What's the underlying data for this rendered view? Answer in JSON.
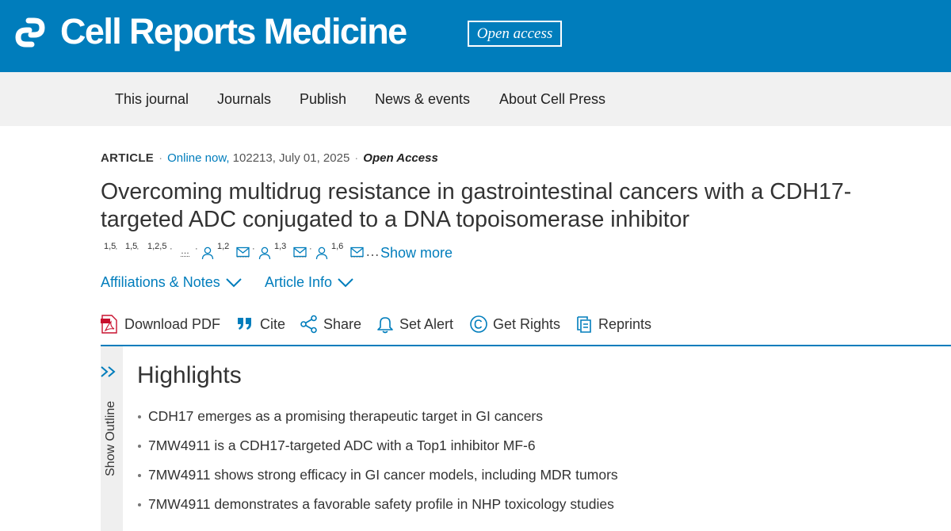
{
  "header": {
    "brand": "Cell Reports Medicine",
    "badge": "Open access",
    "logo_icon": "cell-press-logo-icon",
    "colors": {
      "brand_blue": "#007dbc",
      "nav_bg": "#f1f1f1"
    }
  },
  "nav": [
    "This journal",
    "Journals",
    "Publish",
    "News & events",
    "About Cell Press"
  ],
  "article": {
    "type": "ARTICLE",
    "online": "Online now,",
    "citation": "102213, July 01, 2025",
    "access": "Open Access",
    "title": "Overcoming multidrug resistance in gastrointestinal cancers with a CDH17-targeted ADC conjugated to a DNA topoisomerase inhibitor",
    "authors": [
      {
        "sup": "1,5",
        "sep": "·"
      },
      {
        "sup": "1,5",
        "sep": "·"
      },
      {
        "sup": "1,2,5",
        "sep": "·"
      },
      {
        "sup": "…",
        "sep": "·"
      },
      {
        "sup": "1,2",
        "sep": "·"
      },
      {
        "sup": "1,3",
        "sep": "·"
      },
      {
        "sup": "1,6",
        "sep": ""
      }
    ],
    "ellipsis": "…",
    "show_more": "Show more",
    "affiliations_label": "Affiliations & Notes",
    "article_info_label": "Article Info"
  },
  "toolbar": [
    {
      "label": "Download PDF",
      "icon": "pdf-icon"
    },
    {
      "label": "Cite",
      "icon": "quote-icon"
    },
    {
      "label": "Share",
      "icon": "share-icon"
    },
    {
      "label": "Set Alert",
      "icon": "bell-icon"
    },
    {
      "label": "Get Rights",
      "icon": "copyright-icon"
    },
    {
      "label": "Reprints",
      "icon": "reprints-icon"
    }
  ],
  "outline": {
    "label": "Show Outline"
  },
  "highlights": {
    "heading": "Highlights",
    "items": [
      "CDH17 emerges as a promising therapeutic target in GI cancers",
      "7MW4911 is a CDH17-targeted ADC with a Top1 inhibitor MF-6",
      "7MW4911 shows strong efficacy in GI cancer models, including MDR tumors",
      "7MW4911 demonstrates a favorable safety profile in NHP toxicology studies"
    ]
  }
}
